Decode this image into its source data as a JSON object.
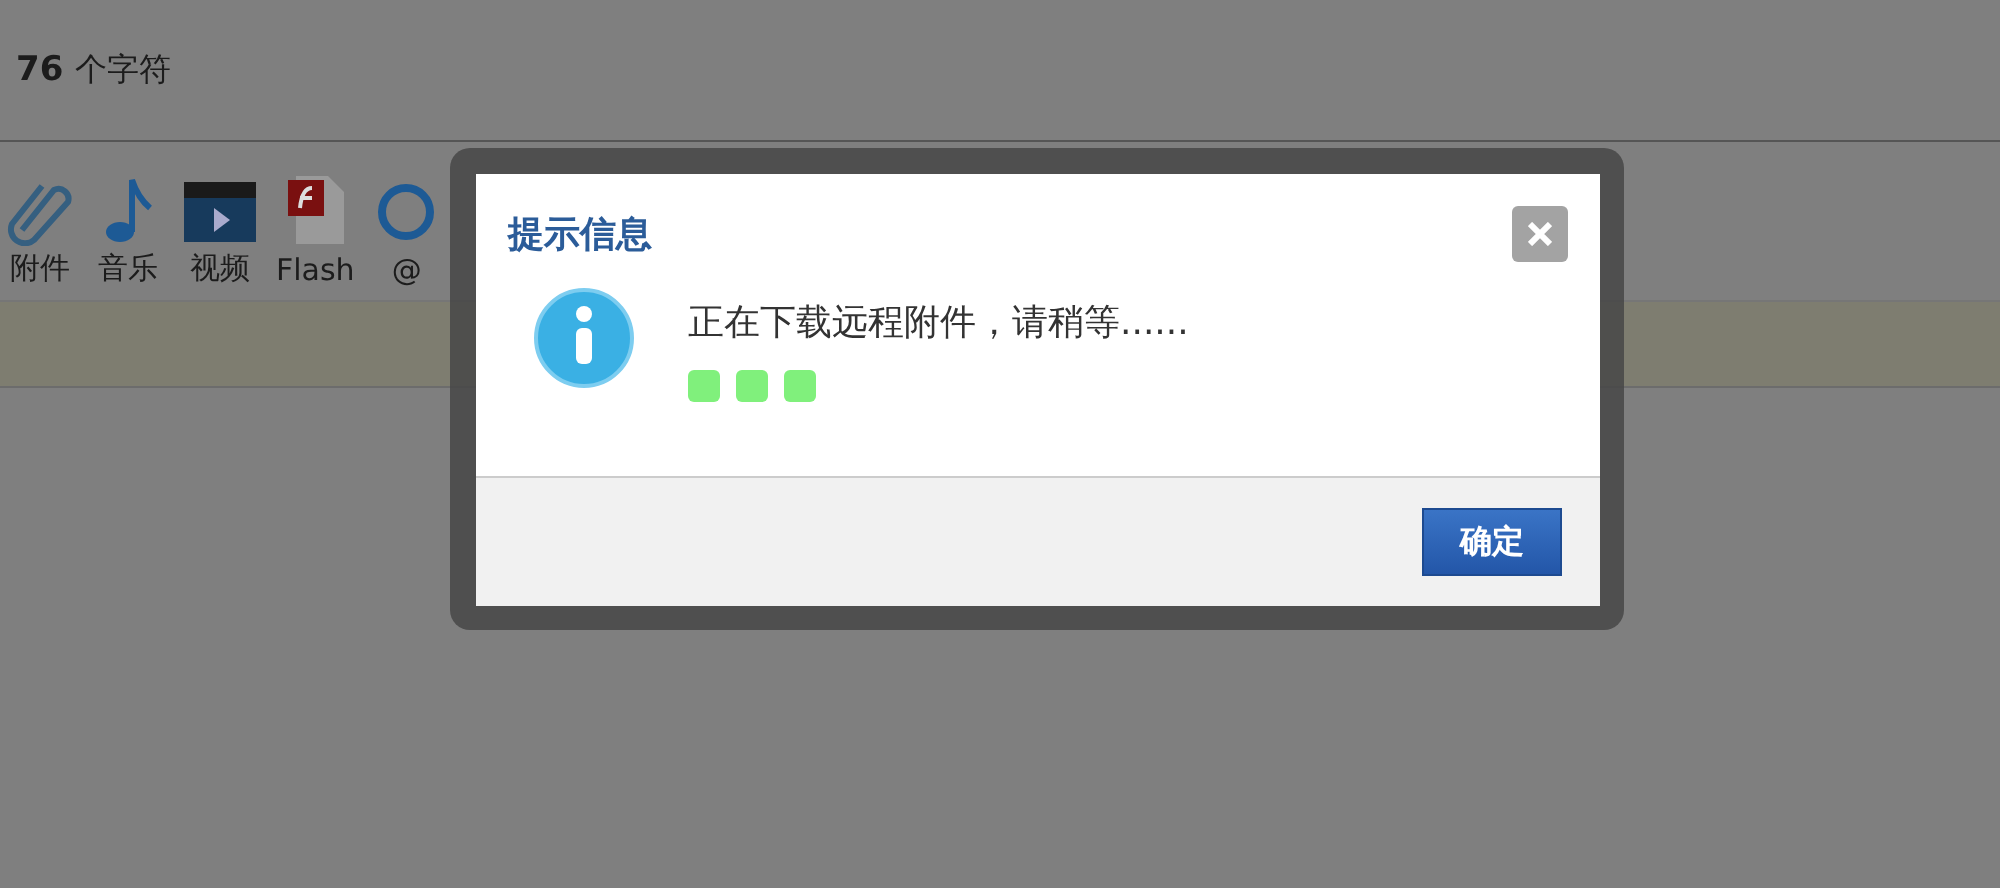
{
  "status": {
    "count": "76",
    "unit": "个字符"
  },
  "toolbar": [
    {
      "kind": "clip",
      "label": "附件"
    },
    {
      "kind": "music",
      "label": "音乐"
    },
    {
      "kind": "video",
      "label": "视频"
    },
    {
      "kind": "flash",
      "label": "Flash"
    },
    {
      "kind": "at",
      "label": "@"
    }
  ],
  "dialog": {
    "title": "提示信息",
    "message": "正在下载远程附件，请稍等......",
    "buttons": [
      "确定"
    ]
  }
}
